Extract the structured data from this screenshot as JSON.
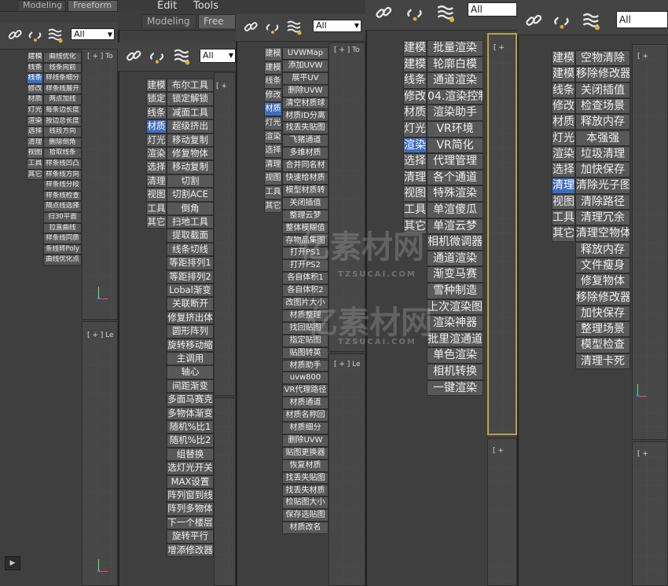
{
  "ribbon": {
    "tab_modeling": "Modeling",
    "tab_freeform": "Freeform",
    "menu_edit": "Edit",
    "menu_tools": "Tools",
    "tab_free_short": "Free"
  },
  "toolbar": {
    "filter_value": "All",
    "icons": [
      "link-icon",
      "unlink-icon",
      "bind-spacewarp-icon"
    ]
  },
  "viewport_labels": {
    "top": "[ + ] To",
    "left": "[ + ] Le",
    "generic": "[ +"
  },
  "watermark": {
    "brand": "亿素材网",
    "url": "TZSUCAI.COM"
  },
  "categories": [
    "建模",
    "建模",
    "线条",
    "修改",
    "材质",
    "灯光",
    "渲染",
    "选择",
    "清理",
    "视图",
    "工具",
    "其它"
  ],
  "panels": {
    "p1": {
      "categories": [
        "建模",
        "线条",
        "线条",
        "修改",
        "材质",
        "灯光",
        "渲染",
        "选择",
        "清理",
        "视图",
        "工具",
        "其它"
      ],
      "items": [
        "曲线优化",
        "线条向前",
        "样线条细分",
        "样条线展开",
        "两点加线",
        "每条边长度",
        "按边总长度",
        "线段方向",
        "删除倒角",
        "拾取线条",
        "样条线凹凸",
        "样条线方向",
        "样条线分段",
        "样条线检查",
        "隔点线选择",
        "归30平面",
        "拉直曲线",
        "样条线同质",
        "条线转Poly",
        "曲线优化点"
      ]
    },
    "p2": {
      "categories": [
        "建模",
        "锁定",
        "线条",
        "材质",
        "灯光",
        "渲染",
        "选择",
        "清理",
        "视图",
        "工具",
        "其它"
      ],
      "items": [
        "布尔工具",
        "锁定解锁",
        "减面工具",
        "超级挤出",
        "移动复制",
        "修复物体",
        "移动复制",
        "切割",
        "切割ACE",
        "倒角",
        "扫地工具",
        "提取截面",
        "线条切线",
        "等距排列1",
        "等距排列2",
        "Lobal渐变",
        "关联断开",
        "修复挤出体",
        "圆形阵列",
        "旋转移动缩",
        "主调用",
        "轴心",
        "间距渐变",
        "多面马赛克",
        "多物体渐变",
        "随机%比1",
        "随机%比2",
        "组替换",
        "选灯光开关",
        "MAX设置",
        "阵列窗到线",
        "阵列多物体",
        "下一个楼层",
        "旋转平行",
        "增添修改器"
      ]
    },
    "p3": {
      "categories": [
        "建模",
        "建模",
        "线条",
        "修改",
        "材质",
        "灯光",
        "渲染",
        "选择",
        "清理",
        "视图",
        "工具",
        "其它"
      ],
      "items": [
        "UVWMap",
        "添加UVW",
        "展平UV",
        "删除UVW",
        "清空材质球",
        "材质ID分离",
        "找丢失贴图",
        "飞猪通道",
        "多维材质",
        "合并同名材",
        "快速给材质",
        "模型材质转",
        "关闭插值",
        "整理云梦",
        "整体模糊值",
        "存物品集图",
        "打开PS1",
        "打开PS2",
        "各自体积1",
        "各自体积2",
        "改图片大小",
        "材质整理",
        "找回贴图",
        "指定贴图",
        "贴图转英",
        "材质助手",
        "uvw800",
        "VR代理路径",
        "材质通道",
        "材质名称回",
        "材质细分",
        "删除UVW",
        "贴图更换器",
        "恢复材质",
        "找丢失贴图",
        "找丢失材质",
        "检贴图大小",
        "保存选贴图",
        "材质改名"
      ]
    },
    "p4": {
      "categories": [
        "建模",
        "建模",
        "线条",
        "修改",
        "材质",
        "灯光",
        "渲染",
        "选择",
        "清理",
        "视图",
        "工具",
        "其它"
      ],
      "items": [
        "批量渲染",
        "轮廓白模",
        "通道渲染",
        "04.渲染控制",
        "渲染助手",
        "VR环境",
        "VR简化",
        "代理管理",
        "各个通道",
        "特殊渲染",
        "单渲傻瓜",
        "单渲云梦",
        "相机微调器",
        "通道渲染",
        "渐变马赛",
        "雪种制造",
        "上次渲染图",
        "渲染神器",
        "批里渲通道",
        "单色渲染",
        "相机转换",
        "一键渲染"
      ]
    },
    "p5": {
      "categories": [
        "建模",
        "建模",
        "线条",
        "修改",
        "材质",
        "灯光",
        "渲染",
        "选择",
        "清理",
        "视图",
        "工具",
        "其它"
      ],
      "items": [
        "空物清除",
        "移除修改器",
        "关闭插值",
        "检查场景",
        "释放内存",
        "本强强",
        "垃圾清理",
        "加快保存",
        "清除光子图",
        "清除路径",
        "清理冗余",
        "清理空物体",
        "释放内存",
        "文件瘦身",
        "修复物体",
        "移除修改器",
        "加快保存",
        "整理场景",
        "模型检查",
        "清理卡死"
      ]
    }
  },
  "playbar": {
    "play_label": "▶"
  }
}
